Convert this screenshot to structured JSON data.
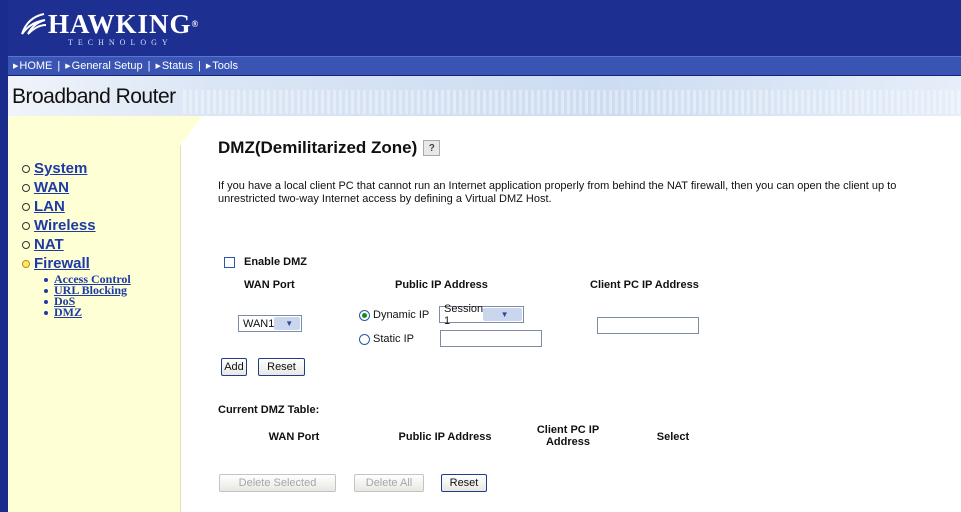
{
  "brand": {
    "name": "HAWKING",
    "tagline": "TECHNOLOGY",
    "registered": "®"
  },
  "nav": {
    "items": [
      {
        "label": "HOME"
      },
      {
        "label": "General Setup"
      },
      {
        "label": "Status"
      },
      {
        "label": "Tools"
      }
    ],
    "separator": "|"
  },
  "header": {
    "title": "Broadband Router"
  },
  "sidebar": {
    "items": [
      {
        "label": "System"
      },
      {
        "label": "WAN"
      },
      {
        "label": "LAN"
      },
      {
        "label": "Wireless"
      },
      {
        "label": "NAT"
      },
      {
        "label": "Firewall"
      }
    ],
    "submenu": [
      {
        "label": "Access Control"
      },
      {
        "label": "URL Blocking"
      },
      {
        "label": "DoS"
      },
      {
        "label": "DMZ"
      }
    ]
  },
  "main": {
    "title": "DMZ(Demilitarized Zone)",
    "help_glyph": "?",
    "description": "If you have a local client PC that cannot run an Internet application properly from behind the NAT firewall, then you can open the client up to unrestricted two-way Internet access by defining a Virtual DMZ Host.",
    "enable_label": "Enable DMZ",
    "enable_checked": false,
    "headers": {
      "wan_port": "WAN Port",
      "public_ip": "Public IP Address",
      "client_ip": "Client PC IP Address"
    },
    "wan_port_value": "WAN1",
    "dynamic_ip_label": "Dynamic IP",
    "dynamic_ip_selected": true,
    "session_value": "Session 1",
    "static_ip_label": "Static IP",
    "static_ip_value": "",
    "client_ip_value": "",
    "add_label": "Add",
    "reset_label": "Reset"
  },
  "table": {
    "title": "Current DMZ Table:",
    "columns": [
      "WAN Port",
      "Public IP Address",
      "Client PC IP\nAddress",
      "Select"
    ],
    "rows": [],
    "delete_selected_label": "Delete Selected",
    "delete_all_label": "Delete All",
    "reset_label": "Reset"
  },
  "colors": {
    "banner": "#1e2f92",
    "navbar": "#3a54b4",
    "sidebar": "#ffffd6",
    "link": "#1d3aa6"
  }
}
